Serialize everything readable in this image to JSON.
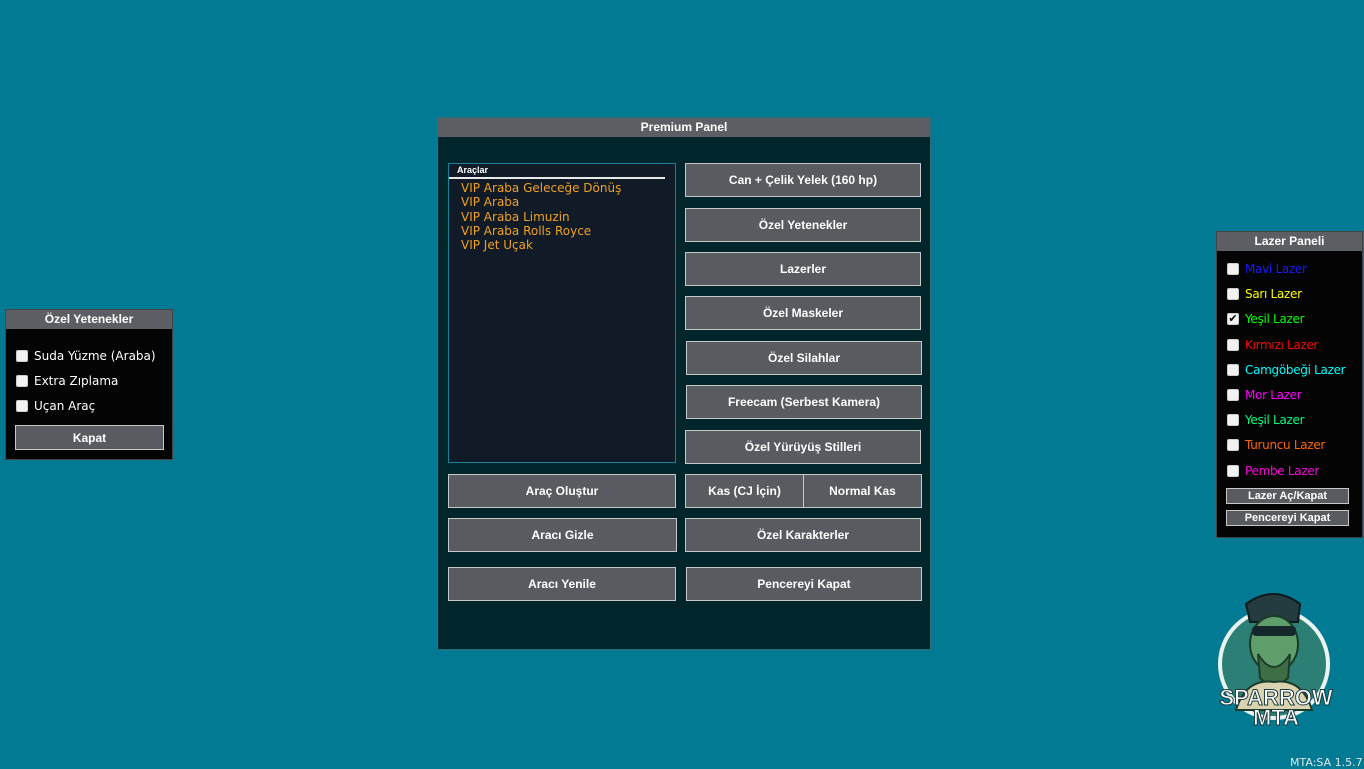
{
  "premium_panel": {
    "title": "Premium Panel",
    "list": {
      "header": "Araçlar",
      "items": [
        "VIP Araba Geleceğe Dönüş",
        "VIP Araba",
        "VIP Araba Limuzin",
        "VIP Araba Rolls Royce",
        "VIP Jet Uçak"
      ]
    },
    "buttons": {
      "can_celik": "Can + Çelik Yelek (160 hp)",
      "ozel_yetenekler": "Özel Yetenekler",
      "lazerler": "Lazerler",
      "ozel_maskeler": "Özel Maskeler",
      "ozel_silahlar": "Özel Silahlar",
      "freecam": "Freecam (Serbest Kamera)",
      "ozel_yuruyus": "Özel Yürüyüş Stilleri",
      "arac_olustur": "Araç Oluştur",
      "kas_cj": "Kas (CJ İçin)",
      "normal_kas": "Normal Kas",
      "araci_gizle": "Aracı Gizle",
      "ozel_karakterler": "Özel Karakterler",
      "araci_yenile": "Aracı Yenile",
      "pencereyi_kapat": "Pencereyi Kapat"
    }
  },
  "ozel_panel": {
    "title": "Özel Yetenekler",
    "options": [
      {
        "label": "Suda Yüzme (Araba)",
        "checked": false
      },
      {
        "label": "Extra Zıplama",
        "checked": false
      },
      {
        "label": "Uçan Araç",
        "checked": false
      }
    ],
    "close": "Kapat"
  },
  "lazer_panel": {
    "title": "Lazer Paneli",
    "options": [
      {
        "label": "Mavi Lazer",
        "color": "#1a1aff",
        "checked": false
      },
      {
        "label": "Sarı Lazer",
        "color": "#ffff00",
        "checked": false
      },
      {
        "label": "Yeşil Lazer",
        "color": "#00ff00",
        "checked": true
      },
      {
        "label": "Kırmızı Lazer",
        "color": "#ff0000",
        "checked": false
      },
      {
        "label": "Camgöbeği Lazer",
        "color": "#00ffff",
        "checked": false
      },
      {
        "label": "Mor Lazer",
        "color": "#ff00ff",
        "checked": false
      },
      {
        "label": "Yeşil Lazer",
        "color": "#00ff7f",
        "checked": false
      },
      {
        "label": "Turuncu Lazer",
        "color": "#ff6600",
        "checked": false
      },
      {
        "label": "Pembe Lazer",
        "color": "#ff00dd",
        "checked": false
      }
    ],
    "toggle": "Lazer Aç/Kapat",
    "close": "Pencereyi Kapat"
  },
  "logo": {
    "line1": "SPARROW",
    "line2": "MTA"
  },
  "version": "MTA:SA 1.5.7"
}
